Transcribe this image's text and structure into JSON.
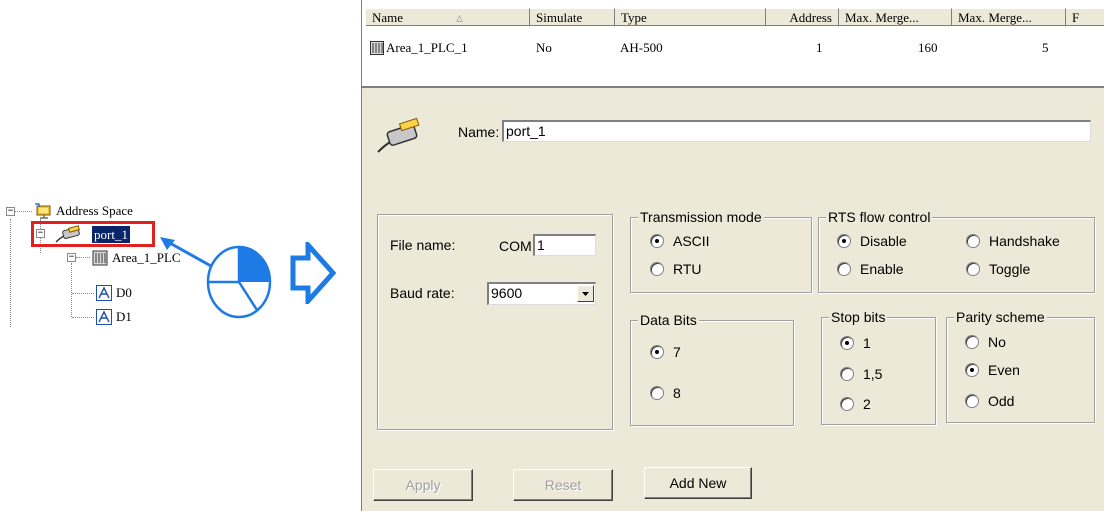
{
  "tree": {
    "root_label": "Address Space",
    "port_label": "port_1",
    "plc_label": "Area_1_PLC",
    "tags": [
      "D0",
      "D1"
    ],
    "expander_symbol": "⊟"
  },
  "table": {
    "columns": [
      "Name",
      "Simulate",
      "Type",
      "Address",
      "Max. Merge...",
      "Max. Merge..."
    ],
    "rows": [
      {
        "name": "Area_1_PLC_1",
        "simulate": "No",
        "type": "AH-500",
        "address": "1",
        "max_merge_1": "160",
        "max_merge_2": "5"
      }
    ]
  },
  "form": {
    "name_label": "Name:",
    "name_value": "port_1",
    "file_name_label": "File name:",
    "com_prefix": "COM",
    "com_value": "1",
    "baud_rate_label": "Baud rate:",
    "baud_rate_value": "9600",
    "transmission_mode": {
      "title": "Transmission mode",
      "options": [
        "ASCII",
        "RTU"
      ],
      "selected": "ASCII"
    },
    "rts_flow_control": {
      "title": "RTS flow control",
      "options": [
        "Disable",
        "Enable",
        "Handshake",
        "Toggle"
      ],
      "selected": "Disable"
    },
    "data_bits": {
      "title": "Data Bits",
      "options": [
        "7",
        "8"
      ],
      "selected": "7"
    },
    "stop_bits": {
      "title": "Stop bits",
      "options": [
        "1",
        "1,5",
        "2"
      ],
      "selected": "1"
    },
    "parity_scheme": {
      "title": "Parity scheme",
      "options": [
        "No",
        "Even",
        "Odd"
      ],
      "selected": "Even"
    }
  },
  "buttons": {
    "apply": "Apply",
    "reset": "Reset",
    "add_new": "Add New"
  },
  "colors": {
    "highlight_box": "#e0211f",
    "selection": "#0a246a",
    "accent_blue": "#1e7be6",
    "panel_bg": "#ece9d8"
  }
}
